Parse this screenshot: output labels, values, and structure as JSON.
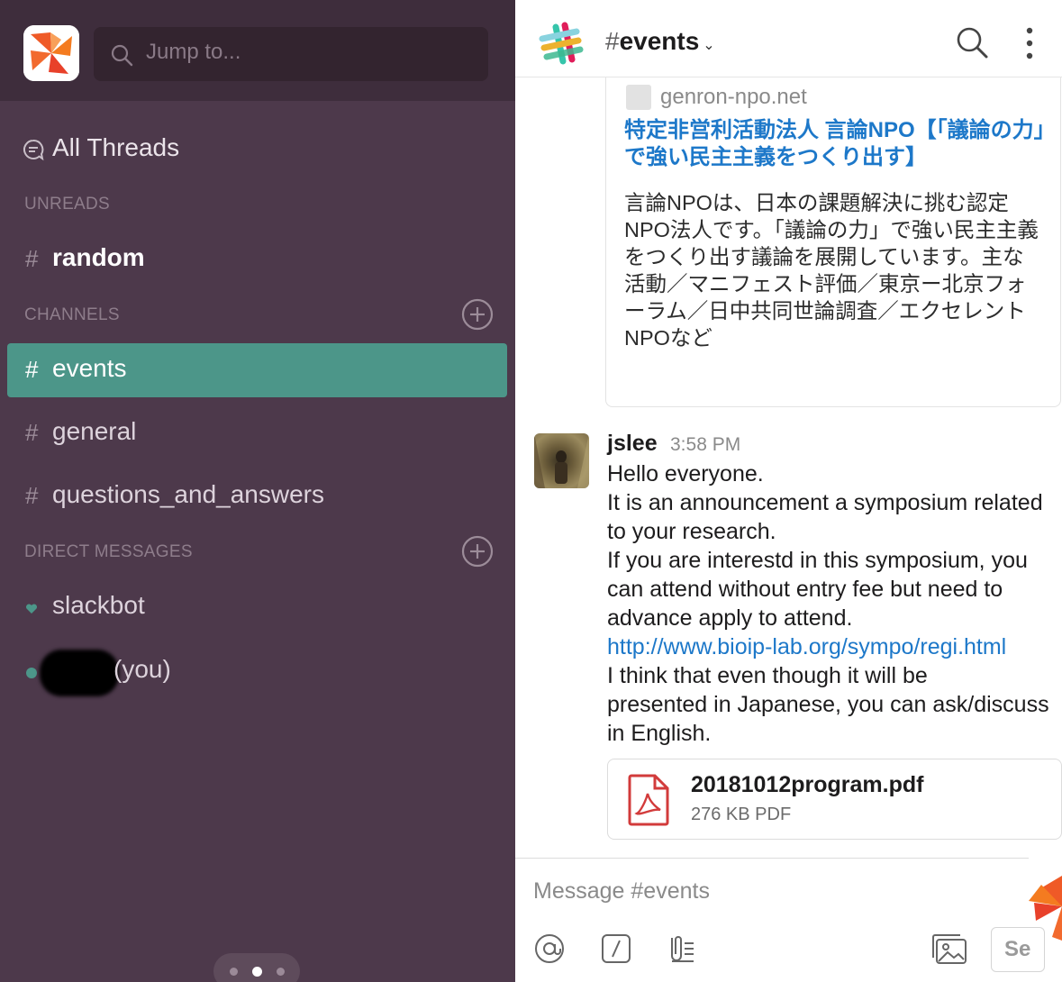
{
  "sidebar": {
    "search_placeholder": "Jump to...",
    "all_threads": "All Threads",
    "sections": {
      "unreads": "UNREADS",
      "channels": "CHANNELS",
      "direct_messages": "DIRECT MESSAGES"
    },
    "unread_channels": [
      {
        "hash": "#",
        "name": "random"
      }
    ],
    "channels": [
      {
        "hash": "#",
        "name": "events"
      },
      {
        "hash": "#",
        "name": "general"
      },
      {
        "hash": "#",
        "name": "questions_and_answers"
      }
    ],
    "dms": [
      {
        "name": "slackbot"
      },
      {
        "name": "(you)"
      }
    ],
    "active_color": "#4c9689",
    "bg_color": "#4d394b"
  },
  "channel": {
    "hash": "#",
    "name": "events",
    "chevron": "⌄"
  },
  "unfurl": {
    "site": "genron-npo.net",
    "title": "特定非営利活動法人 言論NPO【「議論の力」で強い民主主義をつくり出す】",
    "description": "言論NPOは、日本の課題解決に挑む認定NPO法人です。「議論の力」で強い民主主義をつくり出す議論を展開しています。主な活動／マニフェスト評価／東京ー北京フォーラム／日中共同世論調査／エクセレントNPOなど"
  },
  "message": {
    "author": "jslee",
    "time": "3:58 PM",
    "lines": [
      "Hello everyone.",
      "It is an announcement a symposium related",
      "to your research.",
      "If you are interestd in this symposium, you",
      "can attend without entry fee but need to",
      "advance apply to attend."
    ],
    "link": "http://www.bioip-lab.org/sympo/regi.html",
    "lines_after": [
      "I think that even though it will be",
      "presented in Japanese, you can ask/discuss",
      "in English."
    ],
    "file": {
      "name": "20181012program.pdf",
      "meta": "276 KB PDF"
    }
  },
  "composer": {
    "placeholder": "Message #events",
    "send_label": "Se"
  }
}
